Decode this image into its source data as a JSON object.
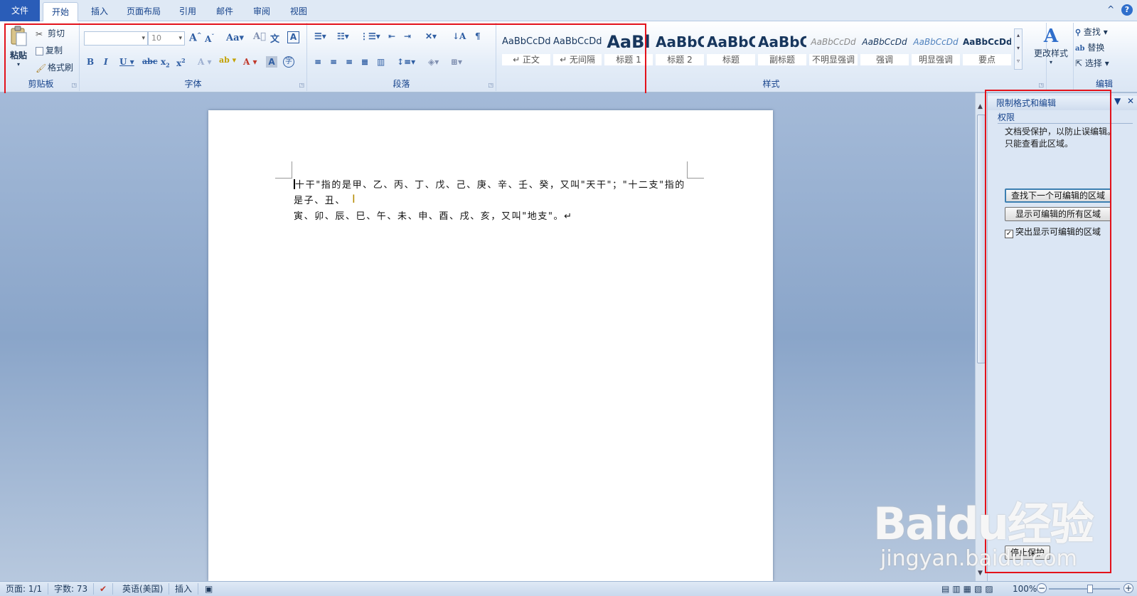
{
  "tabs": [
    {
      "label": "文件"
    },
    {
      "label": "开始"
    },
    {
      "label": "插入"
    },
    {
      "label": "页面布局"
    },
    {
      "label": "引用"
    },
    {
      "label": "邮件"
    },
    {
      "label": "审阅"
    },
    {
      "label": "视图"
    }
  ],
  "ribbon": {
    "clipboard": {
      "label": "剪贴板",
      "paste": "粘贴",
      "cut": "剪切",
      "copy": "复制",
      "format_painter": "格式刷"
    },
    "font": {
      "label": "字体",
      "font_name": "",
      "font_size": "10"
    },
    "paragraph": {
      "label": "段落"
    },
    "styles": {
      "label": "样式",
      "tiles": [
        {
          "sample": "AaBbCcDd",
          "name": "↵ 正文"
        },
        {
          "sample": "AaBbCcDd",
          "name": "↵ 无间隔"
        },
        {
          "sample": "AaBl",
          "name": "标题 1"
        },
        {
          "sample": "AaBbC",
          "name": "标题 2"
        },
        {
          "sample": "AaBbC",
          "name": "标题"
        },
        {
          "sample": "AaBbC",
          "name": "副标题"
        },
        {
          "sample": "AaBbCcDd",
          "name": "不明显强调"
        },
        {
          "sample": "AaBbCcDd",
          "name": "强调"
        },
        {
          "sample": "AaBbCcDd",
          "name": "明显强调"
        },
        {
          "sample": "AaBbCcDd",
          "name": "要点"
        }
      ],
      "change_styles": "更改样式"
    },
    "editing": {
      "label": "编辑",
      "find": "查找",
      "replace": "替换",
      "select": "选择"
    }
  },
  "document": {
    "line1": "十干\"指的是甲、乙、丙、丁、戊、己、庚、辛、壬、癸，又叫\"天干\"；\"十二支\"指的是子、丑、",
    "line2": "寅、卯、辰、巳、午、未、申、酉、戌、亥，又叫\"地支\"。↵"
  },
  "task_pane": {
    "title": "限制格式和编辑",
    "section": "权限",
    "message1": "文档受保护，以防止误编辑。",
    "message2": "只能查看此区域。",
    "find_next": "查找下一个可编辑的区域",
    "show_all": "显示可编辑的所有区域",
    "highlight": "突出显示可编辑的区域",
    "highlight_checked": true,
    "stop_protection": "停止保护"
  },
  "status_bar": {
    "page": "页面: 1/1",
    "word_count": "字数: 73",
    "language": "英语(美国)",
    "mode": "插入",
    "zoom": "100%"
  },
  "watermark": {
    "brand": "Baidu经验",
    "url": "jingyan.baidu.com"
  },
  "colors": {
    "accent": "#2a5db8",
    "highlight_box": "#e3121b"
  }
}
